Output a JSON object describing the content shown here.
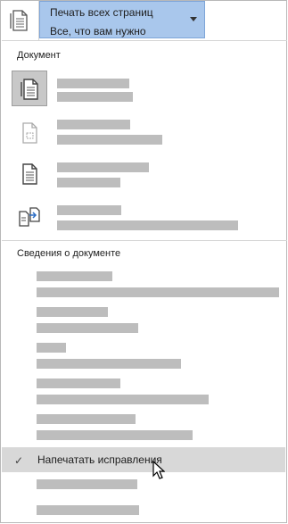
{
  "dropdown": {
    "title": "Печать всех страниц",
    "subtitle": "Все, что вам нужно",
    "icon": "pages-icon",
    "accent": "#a9c7ec"
  },
  "sections": {
    "document_label": "Документ",
    "properties_label": "Сведения о документе"
  },
  "document_options": [
    {
      "icon": "print-document-icon",
      "selected": true
    },
    {
      "icon": "print-markup-icon",
      "selected": false
    },
    {
      "icon": "print-list-of-markup-icon",
      "selected": false
    },
    {
      "icon": "print-properties-icon",
      "selected": false
    }
  ],
  "check_item": {
    "label": "Напечатать исправления",
    "checked": true
  }
}
